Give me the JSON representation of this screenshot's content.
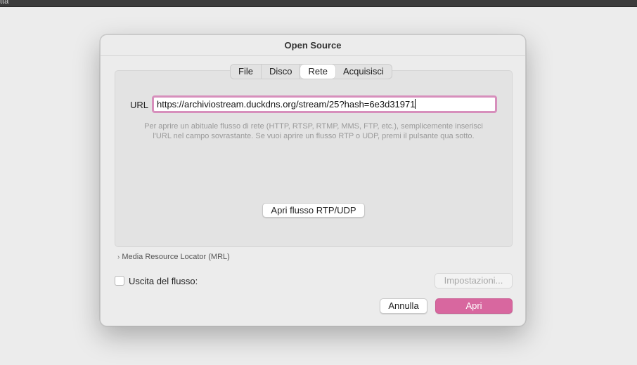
{
  "menubar": {
    "text": "tta"
  },
  "dialog": {
    "title": "Open Source",
    "tabs": [
      {
        "label": "File",
        "active": false
      },
      {
        "label": "Disco",
        "active": false
      },
      {
        "label": "Rete",
        "active": true
      },
      {
        "label": "Acquisisci",
        "active": false
      }
    ],
    "url": {
      "label": "URL",
      "value": "https://archiviostream.duckdns.org/stream/25?hash=6e3d31971"
    },
    "help_line1": "Per aprire un abituale flusso di rete (HTTP, RTSP, RTMP, MMS, FTP, etc.), semplicemente inserisci",
    "help_line2": "l'URL nel campo sovrastante. Se vuoi aprire un flusso RTP o UDP, premi il pulsante qua sotto.",
    "rtp_button": "Apri flusso RTP/UDP",
    "mrl_label": "Media Resource Locator (MRL)",
    "stream_output_label": "Uscita del flusso:",
    "settings_button": "Impostazioni...",
    "cancel_button": "Annulla",
    "open_button": "Apri"
  },
  "colors": {
    "accent": "#d8679f",
    "url_focus_ring": "#d78fbc"
  }
}
